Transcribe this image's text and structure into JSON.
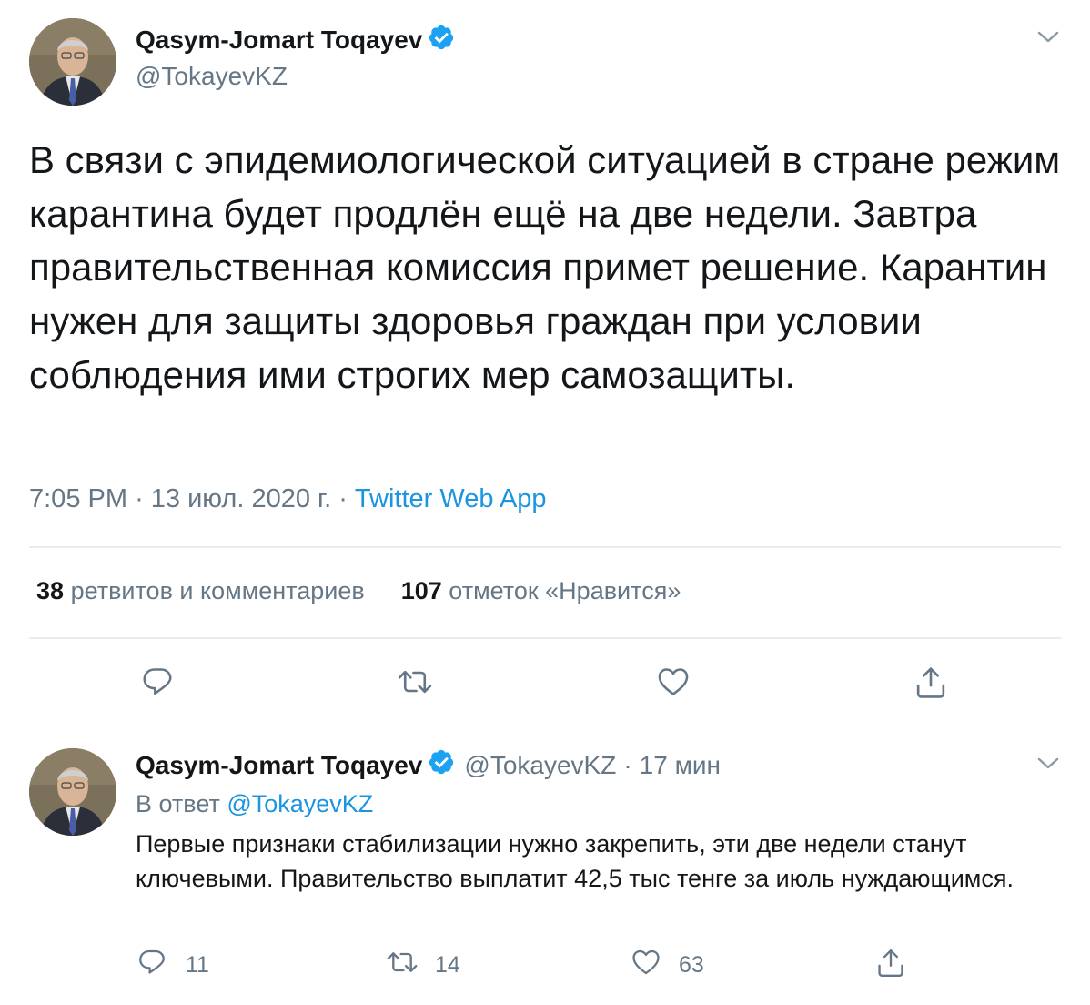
{
  "main_tweet": {
    "author": {
      "name": "Qasym-Jomart Toqayev",
      "handle": "@TokayevKZ",
      "verified": true
    },
    "text": "В связи с эпидемиологической ситуацией в стране режим карантина будет продлён ещё на две недели. Завтра правительственная комиссия примет решение. Карантин нужен для защиты здоровья граждан при условии соблюдения ими строгих мер самозащиты.",
    "time": "7:05 PM",
    "date": "13 июл. 2020 г.",
    "source": "Twitter Web App",
    "retweets_count": "38",
    "retweets_label": "ретвитов и комментариев",
    "likes_count": "107",
    "likes_label": "отметок «Нравится»"
  },
  "reply_tweet": {
    "author": {
      "name": "Qasym-Jomart Toqayev",
      "handle": "@TokayevKZ",
      "verified": true
    },
    "time_ago": "17 мин",
    "reply_prefix": "В ответ",
    "reply_to": "@TokayevKZ",
    "text": "Первые признаки стабилизации нужно закрепить, эти две недели станут ключевыми. Правительство выплатит 42,5 тыс тенге за июль нуждающимся.",
    "reply_count": "11",
    "retweet_count": "14",
    "like_count": "63"
  },
  "separators": {
    "meta_dot": "·"
  },
  "icons": {
    "verified": "verified-badge-icon",
    "menu": "chevron-down-icon",
    "reply": "reply-icon",
    "retweet": "retweet-icon",
    "like": "heart-icon",
    "share": "share-icon"
  },
  "colors": {
    "accent": "#1da1f2",
    "link": "#1b95e0",
    "secondary_text": "#657786",
    "primary_text": "#14171a",
    "divider": "#e6ecf0"
  }
}
